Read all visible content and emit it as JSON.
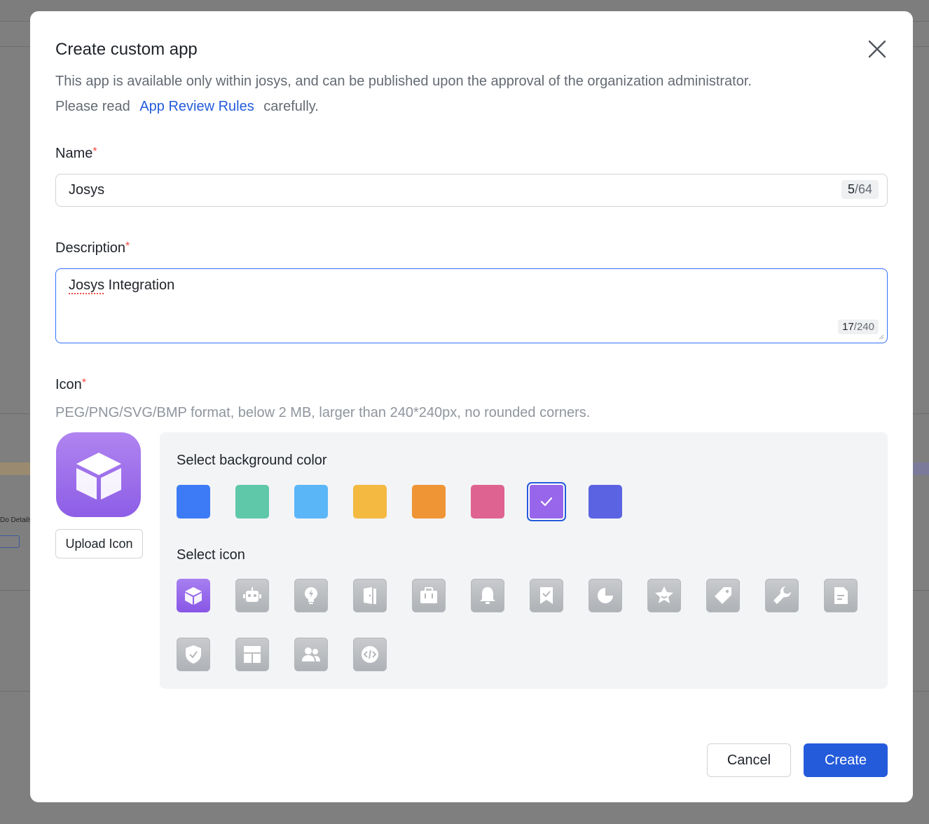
{
  "background": {
    "fragment_text": "Do Details"
  },
  "dialog": {
    "title": "Create custom app",
    "subtitle_line1": "This app is available only within josys, and can be published upon the approval of the organization administrator.",
    "subtitle_prefix": "Please read",
    "subtitle_link": "App Review Rules",
    "subtitle_suffix": "carefully."
  },
  "name_field": {
    "label": "Name",
    "required_mark": "*",
    "value": "Josys",
    "count_current": "5",
    "count_max": "/64"
  },
  "description_field": {
    "label": "Description",
    "required_mark": "*",
    "value_word1": "Josys",
    "value_rest": " Integration",
    "count_current": "17",
    "count_max": "/240"
  },
  "icon_field": {
    "label": "Icon",
    "required_mark": "*",
    "hint": "PEG/PNG/SVG/BMP format, below 2 MB, larger than 240*240px, no rounded corners.",
    "upload_label": "Upload Icon",
    "preview_icon": "cube-icon"
  },
  "color_picker": {
    "heading": "Select background color",
    "selected_index": 6,
    "colors": [
      "#3d7bf6",
      "#5ec8a8",
      "#5ab6f7",
      "#f3b941",
      "#ef9535",
      "#de6390",
      "#9766ea",
      "#5b63e2"
    ]
  },
  "icon_picker": {
    "heading": "Select icon",
    "selected_index": 0,
    "icons": [
      "cube-icon",
      "robot-icon",
      "lightbulb-icon",
      "door-icon",
      "briefcase-icon",
      "bell-icon",
      "bookmark-check-icon",
      "pie-chart-icon",
      "star-badge-icon",
      "tag-icon",
      "wrench-icon",
      "document-icon",
      "shield-check-icon",
      "layout-icon",
      "users-icon",
      "code-icon"
    ]
  },
  "footer": {
    "cancel_label": "Cancel",
    "create_label": "Create"
  }
}
